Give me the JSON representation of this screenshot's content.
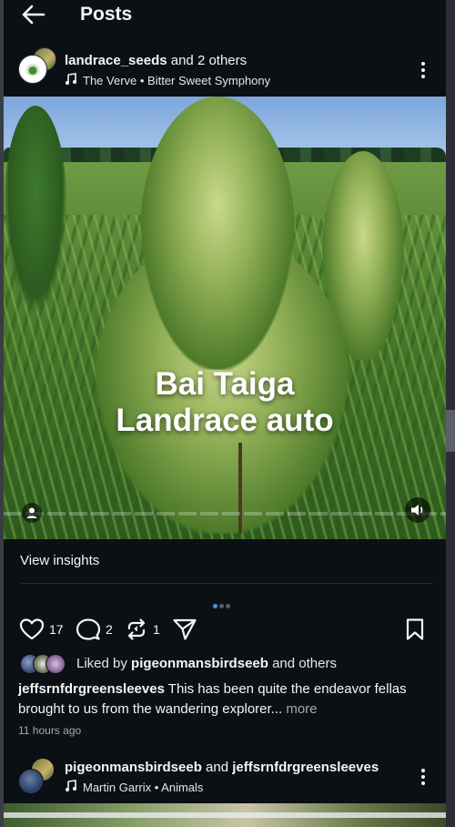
{
  "topbar": {
    "title": "Posts"
  },
  "post": {
    "author_primary": "landrace_seeds",
    "author_suffix": " and 2 others",
    "music": "The Verve • Bitter Sweet Symphony",
    "overlay_line1": "Bai Taiga",
    "overlay_line2": "Landrace auto",
    "insights_label": "View insights",
    "carousel": {
      "total": 3,
      "active": 1
    },
    "likes_count": "17",
    "comments_count": "2",
    "reposts_count": "1",
    "liked_by_prefix": "Liked by ",
    "liked_by_user": "pigeonmansbirdseeb",
    "liked_by_suffix": " and others",
    "caption_user": "jeffsrnfdrgreensleeves",
    "caption_text": " This has been quite the endeavor fellas brought to us from the wandering explorer...",
    "caption_more": " more",
    "timestamp": "11 hours ago"
  },
  "next_post": {
    "author_primary": "pigeonmansbirdseeb",
    "author_mid": " and ",
    "author_secondary": "jeffsrnfdrgreensleeves",
    "music": "Martin Garrix • Animals"
  },
  "icons": {
    "back": "arrow-left-icon",
    "music": "music-note-icon",
    "more": "more-vertical-icon",
    "like": "heart-icon",
    "comment": "comment-icon",
    "repost": "repost-icon",
    "share": "send-icon",
    "save": "bookmark-icon",
    "tag": "user-tag-icon",
    "mute": "speaker-icon"
  },
  "colors": {
    "background": "#0c1014",
    "accent": "#3797f0",
    "muted": "#a8a8a8"
  }
}
